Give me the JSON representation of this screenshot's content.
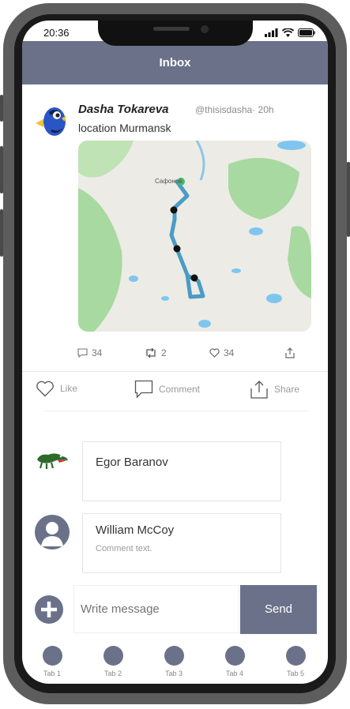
{
  "status_bar": {
    "time": "20:36"
  },
  "header": {
    "title": "Inbox"
  },
  "post": {
    "author": "Dasha Tokareva",
    "handle": "@thisisdasha· 20h",
    "text": "location Murmansk",
    "map_label": "Сафонов",
    "stats": {
      "comments": "34",
      "retweets": "2",
      "likes": "34"
    }
  },
  "actions": {
    "like": "Like",
    "comment": "Comment",
    "share": "Share"
  },
  "comments": [
    {
      "name": "Egor Baranov",
      "text": ""
    },
    {
      "name": "William McCoy",
      "text": "Comment text."
    }
  ],
  "composer": {
    "placeholder": "Write message",
    "send_label": "Send"
  },
  "tabs": [
    "Tab 1",
    "Tab 2",
    "Tab 3",
    "Tab 4",
    "Tab 5"
  ],
  "colors": {
    "accent": "#6b7189",
    "map_green": "#a8d9a0",
    "map_water": "#7fc6ef",
    "route": "#4a9cc4"
  }
}
